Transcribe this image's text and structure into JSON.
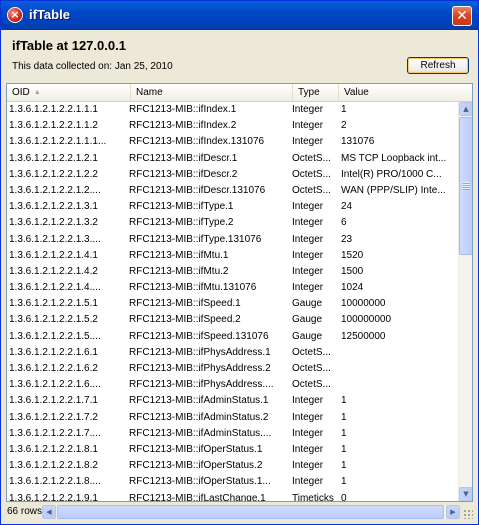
{
  "window": {
    "title": "ifTable"
  },
  "header": {
    "heading": "ifTable at 127.0.0.1",
    "collected": "This data collected on: Jan 25, 2010",
    "refresh_label": "Refresh"
  },
  "table": {
    "columns": [
      {
        "label": "OID",
        "sorted": "ascending"
      },
      {
        "label": "Name"
      },
      {
        "label": "Type"
      },
      {
        "label": "Value"
      }
    ],
    "rows": [
      {
        "oid": "1.3.6.1.2.1.2.2.1.1.1",
        "name": "RFC1213-MIB::ifIndex.1",
        "type": "Integer",
        "value": "1"
      },
      {
        "oid": "1.3.6.1.2.1.2.2.1.1.2",
        "name": "RFC1213-MIB::ifIndex.2",
        "type": "Integer",
        "value": "2"
      },
      {
        "oid": "1.3.6.1.2.1.2.2.1.1.1...",
        "name": "RFC1213-MIB::ifIndex.131076",
        "type": "Integer",
        "value": "131076"
      },
      {
        "oid": "1.3.6.1.2.1.2.2.1.2.1",
        "name": "RFC1213-MIB::ifDescr.1",
        "type": "OctetS...",
        "value": "MS TCP Loopback int..."
      },
      {
        "oid": "1.3.6.1.2.1.2.2.1.2.2",
        "name": "RFC1213-MIB::ifDescr.2",
        "type": "OctetS...",
        "value": "Intel(R) PRO/1000 C..."
      },
      {
        "oid": "1.3.6.1.2.1.2.2.1.2....",
        "name": "RFC1213-MIB::ifDescr.131076",
        "type": "OctetS...",
        "value": "WAN (PPP/SLIP) Inte..."
      },
      {
        "oid": "1.3.6.1.2.1.2.2.1.3.1",
        "name": "RFC1213-MIB::ifType.1",
        "type": "Integer",
        "value": "24"
      },
      {
        "oid": "1.3.6.1.2.1.2.2.1.3.2",
        "name": "RFC1213-MIB::ifType.2",
        "type": "Integer",
        "value": "6"
      },
      {
        "oid": "1.3.6.1.2.1.2.2.1.3....",
        "name": "RFC1213-MIB::ifType.131076",
        "type": "Integer",
        "value": "23"
      },
      {
        "oid": "1.3.6.1.2.1.2.2.1.4.1",
        "name": "RFC1213-MIB::ifMtu.1",
        "type": "Integer",
        "value": "1520"
      },
      {
        "oid": "1.3.6.1.2.1.2.2.1.4.2",
        "name": "RFC1213-MIB::ifMtu.2",
        "type": "Integer",
        "value": "1500"
      },
      {
        "oid": "1.3.6.1.2.1.2.2.1.4....",
        "name": "RFC1213-MIB::ifMtu.131076",
        "type": "Integer",
        "value": "1024"
      },
      {
        "oid": "1.3.6.1.2.1.2.2.1.5.1",
        "name": "RFC1213-MIB::ifSpeed.1",
        "type": "Gauge",
        "value": "10000000"
      },
      {
        "oid": "1.3.6.1.2.1.2.2.1.5.2",
        "name": "RFC1213-MIB::ifSpeed.2",
        "type": "Gauge",
        "value": "100000000"
      },
      {
        "oid": "1.3.6.1.2.1.2.2.1.5....",
        "name": "RFC1213-MIB::ifSpeed.131076",
        "type": "Gauge",
        "value": "12500000"
      },
      {
        "oid": "1.3.6.1.2.1.2.2.1.6.1",
        "name": "RFC1213-MIB::ifPhysAddress.1",
        "type": "OctetS...",
        "value": ""
      },
      {
        "oid": "1.3.6.1.2.1.2.2.1.6.2",
        "name": "RFC1213-MIB::ifPhysAddress.2",
        "type": "OctetS...",
        "value": ""
      },
      {
        "oid": "1.3.6.1.2.1.2.2.1.6....",
        "name": "RFC1213-MIB::ifPhysAddress....",
        "type": "OctetS...",
        "value": ""
      },
      {
        "oid": "1.3.6.1.2.1.2.2.1.7.1",
        "name": "RFC1213-MIB::ifAdminStatus.1",
        "type": "Integer",
        "value": "1"
      },
      {
        "oid": "1.3.6.1.2.1.2.2.1.7.2",
        "name": "RFC1213-MIB::ifAdminStatus.2",
        "type": "Integer",
        "value": "1"
      },
      {
        "oid": "1.3.6.1.2.1.2.2.1.7....",
        "name": "RFC1213-MIB::ifAdminStatus....",
        "type": "Integer",
        "value": "1"
      },
      {
        "oid": "1.3.6.1.2.1.2.2.1.8.1",
        "name": "RFC1213-MIB::ifOperStatus.1",
        "type": "Integer",
        "value": "1"
      },
      {
        "oid": "1.3.6.1.2.1.2.2.1.8.2",
        "name": "RFC1213-MIB::ifOperStatus.2",
        "type": "Integer",
        "value": "1"
      },
      {
        "oid": "1.3.6.1.2.1.2.2.1.8....",
        "name": "RFC1213-MIB::ifOperStatus.1...",
        "type": "Integer",
        "value": "1"
      },
      {
        "oid": "1.3.6.1.2.1.2.2.1.9.1",
        "name": "RFC1213-MIB::ifLastChange.1",
        "type": "Timeticks",
        "value": "0"
      }
    ]
  },
  "footer": {
    "row_count": "66 rows"
  },
  "icons": {
    "app": "error-x-icon",
    "close": "close-icon",
    "sort": "sort-ascending-icon"
  },
  "colors": {
    "titlebar": "#0047c8",
    "face": "#ece9d8",
    "close": "#d7451f"
  }
}
